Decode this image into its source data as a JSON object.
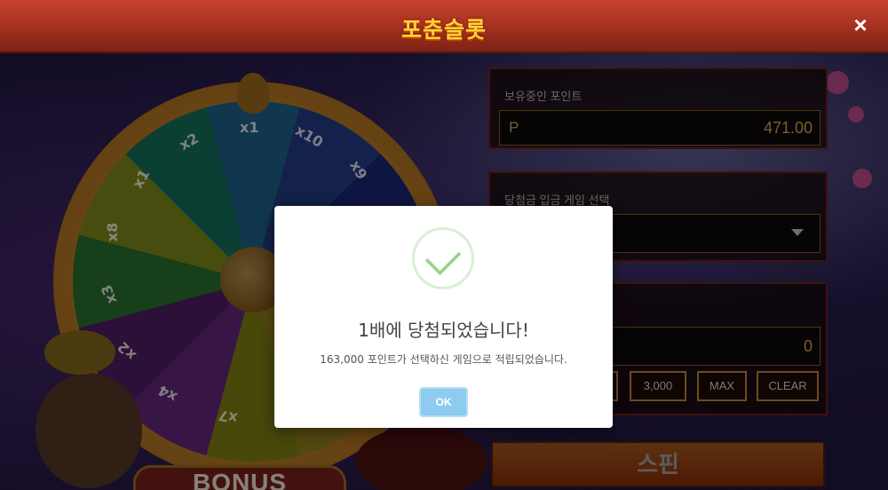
{
  "header": {
    "title": "포춘슬롯",
    "close_label": "×"
  },
  "wheel": {
    "multipliers": [
      "x1",
      "x10",
      "x9",
      "x2",
      "x1",
      "x8",
      "x3",
      "x2",
      "x4",
      "x7"
    ]
  },
  "bonus_label": "BONUS",
  "points_panel": {
    "label": "보유중인 포인트",
    "prefix": "P",
    "value": "471.00"
  },
  "game_select_panel": {
    "label": "당첨금 입금 게임 선택",
    "selected": ""
  },
  "bet_panel": {
    "amount": "0",
    "buttons": [
      "3,000",
      "MAX",
      "CLEAR"
    ]
  },
  "spin_label": "스핀",
  "modal": {
    "title": "1배에 당첨되었습니다!",
    "message": "163,000 포인트가 선택하신 게임으로 적립되었습니다.",
    "ok_label": "OK"
  },
  "colors": {
    "header": "#a2301f",
    "title_gold": "#ffd23a",
    "success_green": "#9bd58c",
    "ok_button": "#8dcbf0",
    "spin_orange": "#f06416"
  }
}
